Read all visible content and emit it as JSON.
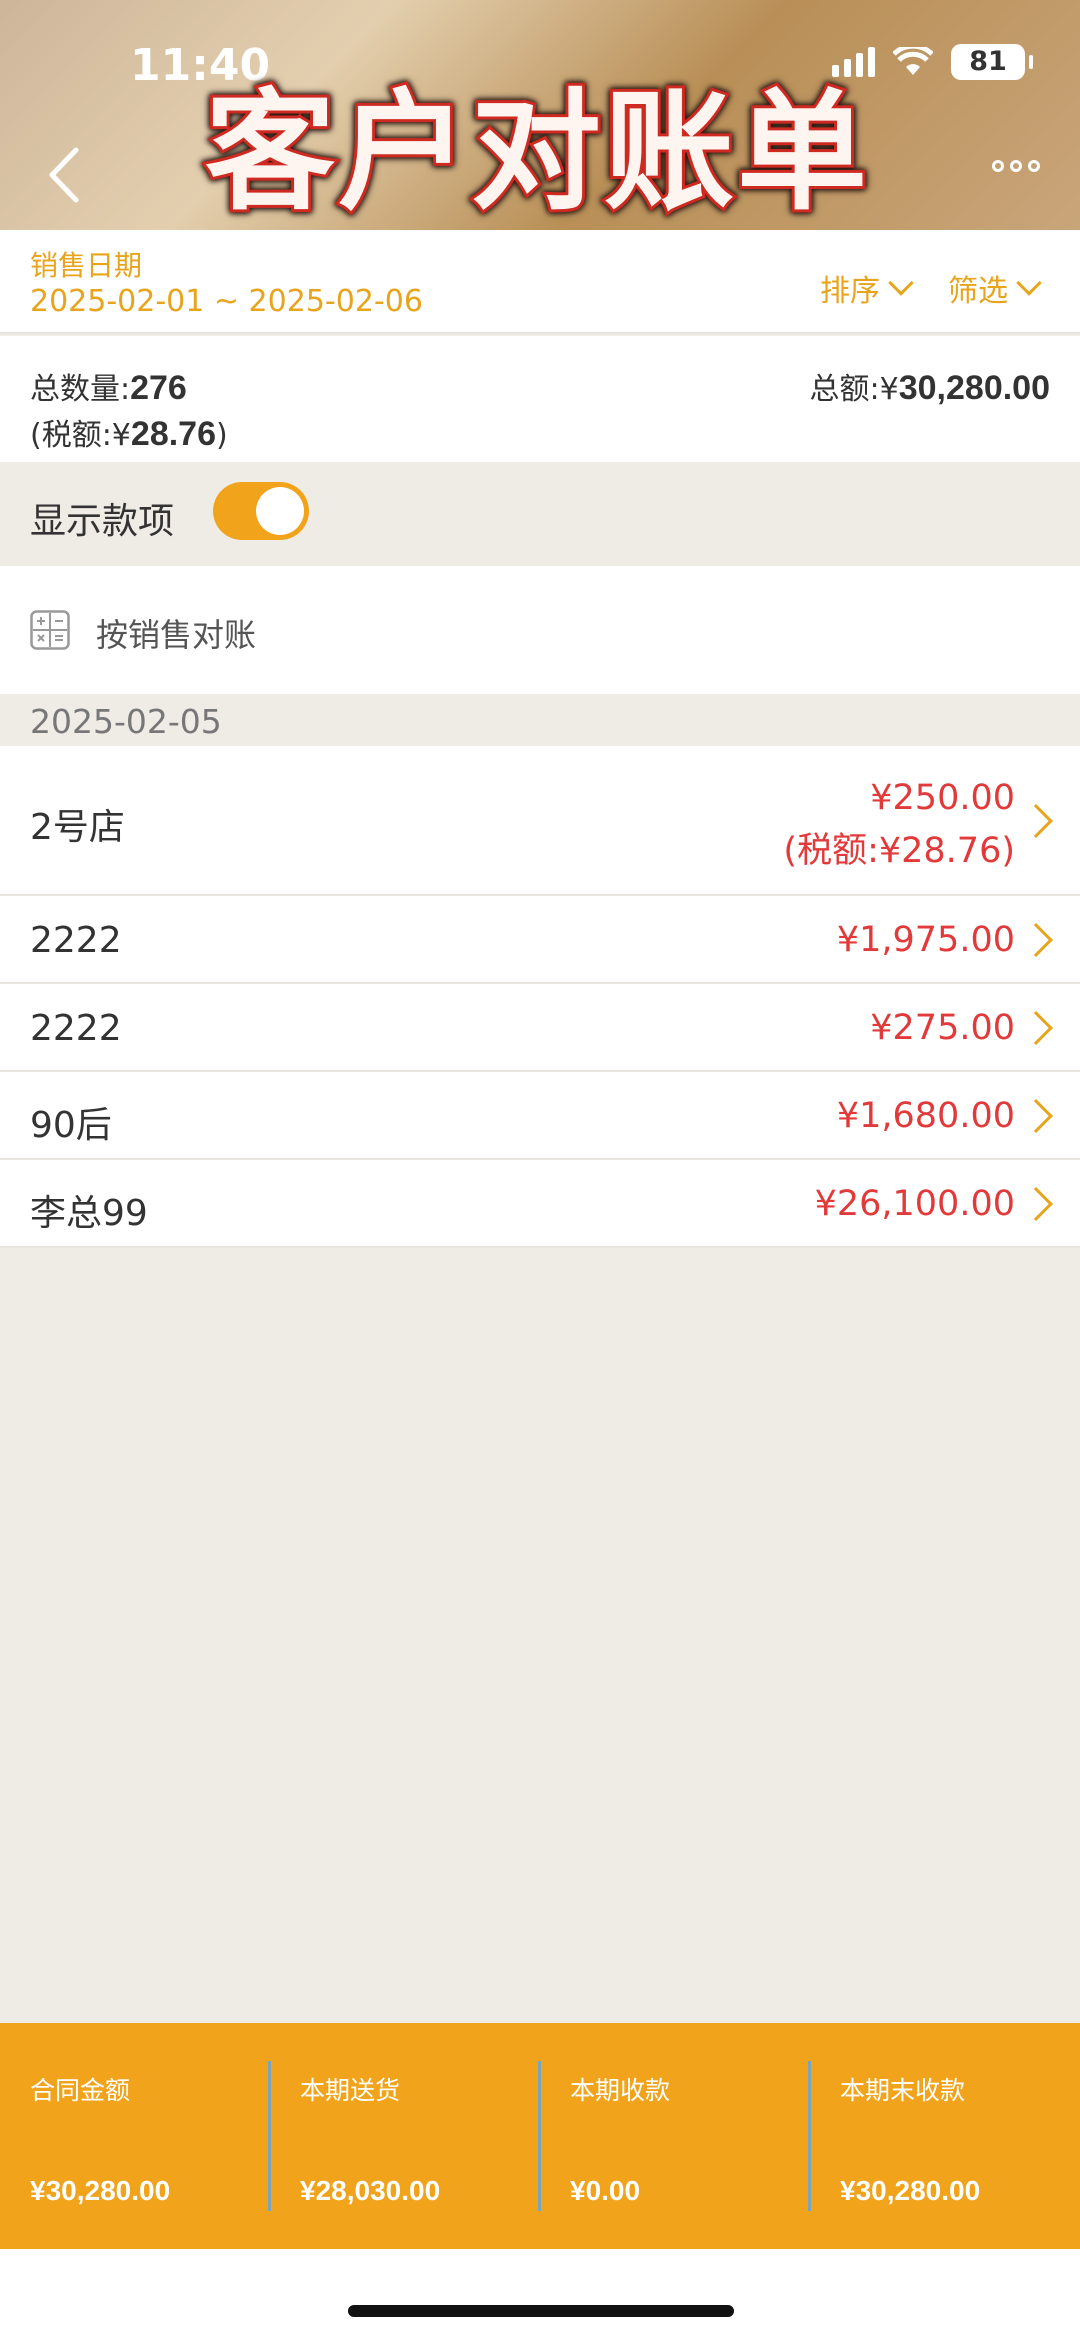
{
  "status_bar": {
    "time": "11:40",
    "battery": "81"
  },
  "header": {
    "title_overlay": "客户对账单"
  },
  "filter": {
    "date_label": "销售日期",
    "date_range": "2025-02-01 ~ 2025-02-06",
    "sort_label": "排序",
    "filter_label": "筛选"
  },
  "totals": {
    "qty_label": "总数量:",
    "qty_value": "276",
    "tax_prefix": "(税额:¥",
    "tax_value": "28.76",
    "tax_suffix": ")",
    "amount_label": "总额:¥",
    "amount_value": "30,280.00"
  },
  "toggle": {
    "label": "显示款项",
    "state": "on"
  },
  "recon": {
    "label": "按销售对账"
  },
  "list": {
    "date": "2025-02-05",
    "items": [
      {
        "name": "2号店",
        "amount": "¥250.00",
        "tax": "(税额:¥28.76)"
      },
      {
        "name": "2222",
        "amount": "¥1,975.00"
      },
      {
        "name": "2222",
        "amount": "¥275.00"
      },
      {
        "name": "90后",
        "amount": "¥1,680.00"
      },
      {
        "name": "李总99",
        "amount": "¥26,100.00"
      }
    ]
  },
  "footer": [
    {
      "label": "合同金额",
      "value": "¥30,280.00"
    },
    {
      "label": "本期送货",
      "value": "¥28,030.00"
    },
    {
      "label": "本期收款",
      "value": "¥0.00"
    },
    {
      "label": "本期末收款",
      "value": "¥30,280.00"
    }
  ],
  "colors": {
    "accent": "#f0a31b",
    "amount_red": "#e23a3a",
    "background": "#efece6"
  },
  "icons": [
    "back-icon",
    "more-icon",
    "chevron-down-icon",
    "calculator-icon",
    "chevron-right-icon",
    "wifi-icon",
    "signal-icon",
    "battery-icon"
  ]
}
